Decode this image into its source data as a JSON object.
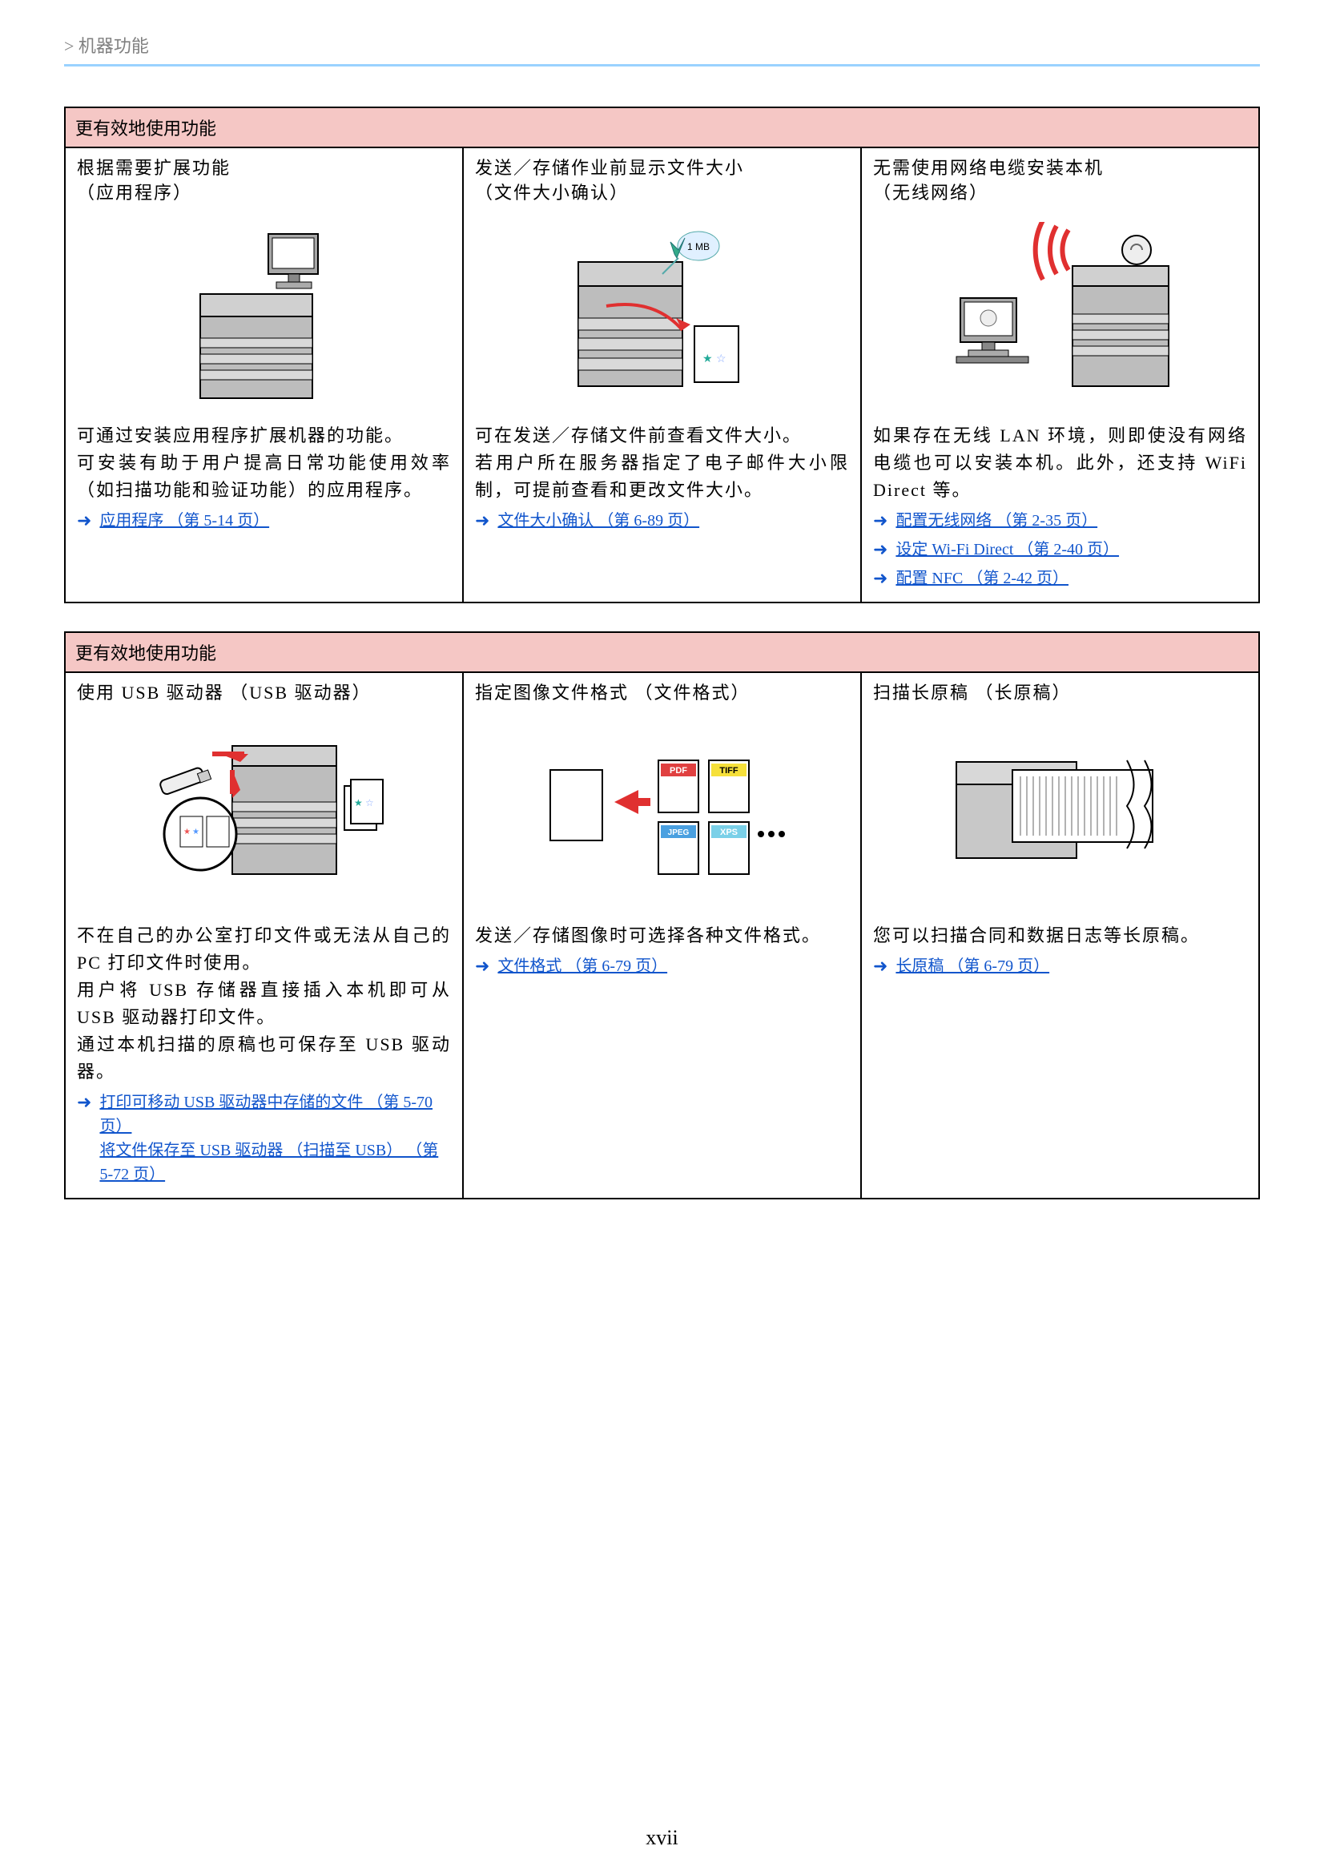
{
  "header": {
    "breadcrumb": "> 机器功能"
  },
  "page_number": "xvii",
  "tables": [
    {
      "title": "更有效地使用功能",
      "cells": [
        {
          "title": "根据需要扩展功能\n（应用程序）",
          "body": [
            "可通过安装应用程序扩展机器的功能。",
            "可安装有助于用户提高日常功能使用效率 （如扫描功能和验证功能）的应用程序。"
          ],
          "links": [
            "应用程序 （第 5-14 页）"
          ]
        },
        {
          "title": "发送／存储作业前显示文件大小\n（文件大小确认）",
          "body": [
            "可在发送／存储文件前查看文件大小。",
            "若用户所在服务器指定了电子邮件大小限制，可提前查看和更改文件大小。"
          ],
          "links": [
            "文件大小确认 （第 6-89 页）"
          ]
        },
        {
          "title": "无需使用网络电缆安装本机\n（无线网络）",
          "body": [
            "如果存在无线 LAN 环境，则即使没有网络电缆也可以安装本机。此外，还支持 WiFi Direct 等。"
          ],
          "links": [
            "配置无线网络 （第 2-35 页）",
            "设定 Wi-Fi Direct （第 2-40 页）",
            "配置 NFC （第 2-42 页）"
          ]
        }
      ]
    },
    {
      "title": "更有效地使用功能",
      "cells": [
        {
          "title": "使用 USB 驱动器 （USB 驱动器）",
          "body": [
            "不在自己的办公室打印文件或无法从自己的 PC 打印文件时使用。",
            "用户将 USB 存储器直接插入本机即可从 USB 驱动器打印文件。",
            "通过本机扫描的原稿也可保存至 USB 驱动器。"
          ],
          "links": [
            "打印可移动 USB 驱动器中存储的文件 （第 5-70 页）",
            "将文件保存至 USB 驱动器 （扫描至 USB） （第 5-72 页）"
          ]
        },
        {
          "title": "指定图像文件格式 （文件格式）",
          "body": [
            "发送／存储图像时可选择各种文件格式。"
          ],
          "links": [
            "文件格式 （第 6-79 页）"
          ]
        },
        {
          "title": "扫描长原稿 （长原稿）",
          "body": [
            "您可以扫描合同和数据日志等长原稿。"
          ],
          "links": [
            "长原稿 （第 6-79 页）"
          ]
        }
      ]
    }
  ],
  "badges": {
    "file_size": "1 MB",
    "pdf": "PDF",
    "tiff": "TIFF",
    "jpeg": "JPEG",
    "xps": "XPS"
  }
}
